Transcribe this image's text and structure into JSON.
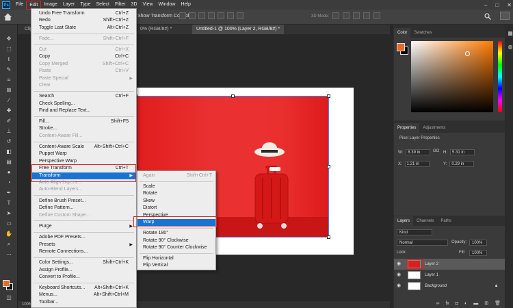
{
  "menubar": {
    "logo": "Ps",
    "items": [
      "File",
      "Edit",
      "Image",
      "Layer",
      "Type",
      "Select",
      "Filter",
      "3D",
      "View",
      "Window",
      "Help"
    ],
    "window_controls": [
      "–",
      "□",
      "✕"
    ]
  },
  "optionsbar": {
    "transform_controls": "Show Transform Controls",
    "mode3d": "3D Mode:"
  },
  "tabs": {
    "clip": "Clip",
    "prev": "0% (RGB/8#) *",
    "active": "Untitled-1 @ 100% (Layer 2, RGB/8#) *"
  },
  "status": "100%",
  "edit_menu": {
    "items": [
      {
        "label": "Undo Free Transform",
        "shortcut": "Ctrl+Z",
        "disabled": false
      },
      {
        "label": "Redo",
        "shortcut": "Shift+Ctrl+Z",
        "disabled": false
      },
      {
        "label": "Toggle Last State",
        "shortcut": "Alt+Ctrl+Z",
        "disabled": false
      },
      {
        "label": "Fade...",
        "shortcut": "Shift+Ctrl+F",
        "disabled": true
      },
      {
        "label": "Cut",
        "shortcut": "Ctrl+X",
        "disabled": true
      },
      {
        "label": "Copy",
        "shortcut": "Ctrl+C",
        "disabled": false
      },
      {
        "label": "Copy Merged",
        "shortcut": "Shift+Ctrl+C",
        "disabled": true
      },
      {
        "label": "Paste",
        "shortcut": "Ctrl+V",
        "disabled": true
      },
      {
        "label": "Paste Special",
        "shortcut": "",
        "disabled": true
      },
      {
        "label": "Clear",
        "shortcut": "",
        "disabled": true
      },
      {
        "label": "Search",
        "shortcut": "Ctrl+F",
        "disabled": false
      },
      {
        "label": "Check Spelling...",
        "shortcut": "",
        "disabled": false
      },
      {
        "label": "Find and Replace Text...",
        "shortcut": "",
        "disabled": false
      },
      {
        "label": "Fill...",
        "shortcut": "Shift+F5",
        "disabled": false
      },
      {
        "label": "Stroke...",
        "shortcut": "",
        "disabled": false
      },
      {
        "label": "Content-Aware Fill...",
        "shortcut": "",
        "disabled": true
      },
      {
        "label": "Content-Aware Scale",
        "shortcut": "Alt+Shift+Ctrl+C",
        "disabled": false
      },
      {
        "label": "Puppet Warp",
        "shortcut": "",
        "disabled": false
      },
      {
        "label": "Perspective Warp",
        "shortcut": "",
        "disabled": false
      },
      {
        "label": "Free Transform",
        "shortcut": "Ctrl+T",
        "disabled": false
      },
      {
        "label": "Transform",
        "shortcut": "",
        "disabled": false
      },
      {
        "label": "Auto-Align Layers...",
        "shortcut": "",
        "disabled": true
      },
      {
        "label": "Auto-Blend Layers...",
        "shortcut": "",
        "disabled": true
      },
      {
        "label": "Define Brush Preset...",
        "shortcut": "",
        "disabled": false
      },
      {
        "label": "Define Pattern...",
        "shortcut": "",
        "disabled": false
      },
      {
        "label": "Define Custom Shape...",
        "shortcut": "",
        "disabled": true
      },
      {
        "label": "Purge",
        "shortcut": "",
        "disabled": false
      },
      {
        "label": "Adobe PDF Presets...",
        "shortcut": "",
        "disabled": false
      },
      {
        "label": "Presets",
        "shortcut": "",
        "disabled": false
      },
      {
        "label": "Remote Connections...",
        "shortcut": "",
        "disabled": false
      },
      {
        "label": "Color Settings...",
        "shortcut": "Shift+Ctrl+K",
        "disabled": false
      },
      {
        "label": "Assign Profile...",
        "shortcut": "",
        "disabled": false
      },
      {
        "label": "Convert to Profile...",
        "shortcut": "",
        "disabled": false
      },
      {
        "label": "Keyboard Shortcuts...",
        "shortcut": "Alt+Shift+Ctrl+K",
        "disabled": false
      },
      {
        "label": "Menus...",
        "shortcut": "Alt+Shift+Ctrl+M",
        "disabled": false
      },
      {
        "label": "Toolbar...",
        "shortcut": "",
        "disabled": false
      }
    ]
  },
  "transform_menu": {
    "items": [
      {
        "label": "Again",
        "shortcut": "Shift+Ctrl+T",
        "disabled": true
      },
      {
        "label": "Scale",
        "shortcut": "",
        "disabled": false
      },
      {
        "label": "Rotate",
        "shortcut": "",
        "disabled": false
      },
      {
        "label": "Skew",
        "shortcut": "",
        "disabled": false
      },
      {
        "label": "Distort",
        "shortcut": "",
        "disabled": false
      },
      {
        "label": "Perspective",
        "shortcut": "",
        "disabled": false
      },
      {
        "label": "Warp",
        "shortcut": "",
        "disabled": false
      },
      {
        "label": "Rotate 180°",
        "shortcut": "",
        "disabled": false
      },
      {
        "label": "Rotate 90° Clockwise",
        "shortcut": "",
        "disabled": false
      },
      {
        "label": "Rotate 90° Counter Clockwise",
        "shortcut": "",
        "disabled": false
      },
      {
        "label": "Flip Horizontal",
        "shortcut": "",
        "disabled": false
      },
      {
        "label": "Flip Vertical",
        "shortcut": "",
        "disabled": false
      }
    ]
  },
  "color_panel": {
    "tabs": [
      "Color",
      "Swatches"
    ],
    "fg": "#e56b2a",
    "bg": "#000000"
  },
  "properties_panel": {
    "tabs": [
      "Properties",
      "Adjustments"
    ],
    "title": "Pixel Layer Properties",
    "w_label": "W:",
    "w_value": "8.39 in",
    "h_label": "H:",
    "h_value": "5.31 in",
    "link": "GO",
    "x_label": "X:",
    "x_value": "1.21 in",
    "y_label": "Y:",
    "y_value": "0.29 in"
  },
  "layers_panel": {
    "tabs": [
      "Layers",
      "Channels",
      "Paths"
    ],
    "kind": "Kind",
    "blend_mode": "Normal",
    "opacity_label": "Opacity:",
    "opacity_value": "100%",
    "lock_label": "Lock:",
    "fill_label": "Fill:",
    "fill_value": "100%",
    "layers": [
      {
        "name": "Layer 2",
        "selected": true
      },
      {
        "name": "Layer 1",
        "selected": false
      },
      {
        "name": "Background",
        "selected": false
      }
    ],
    "footer_icons": [
      "link-icon",
      "fx-icon",
      "mask-icon",
      "adjustment-icon",
      "group-icon",
      "new-layer-icon",
      "trash-icon"
    ]
  },
  "colors": {
    "highlight": "#1873d3",
    "annotation_red": "#e02020",
    "photo_red": "#e01d1d"
  }
}
